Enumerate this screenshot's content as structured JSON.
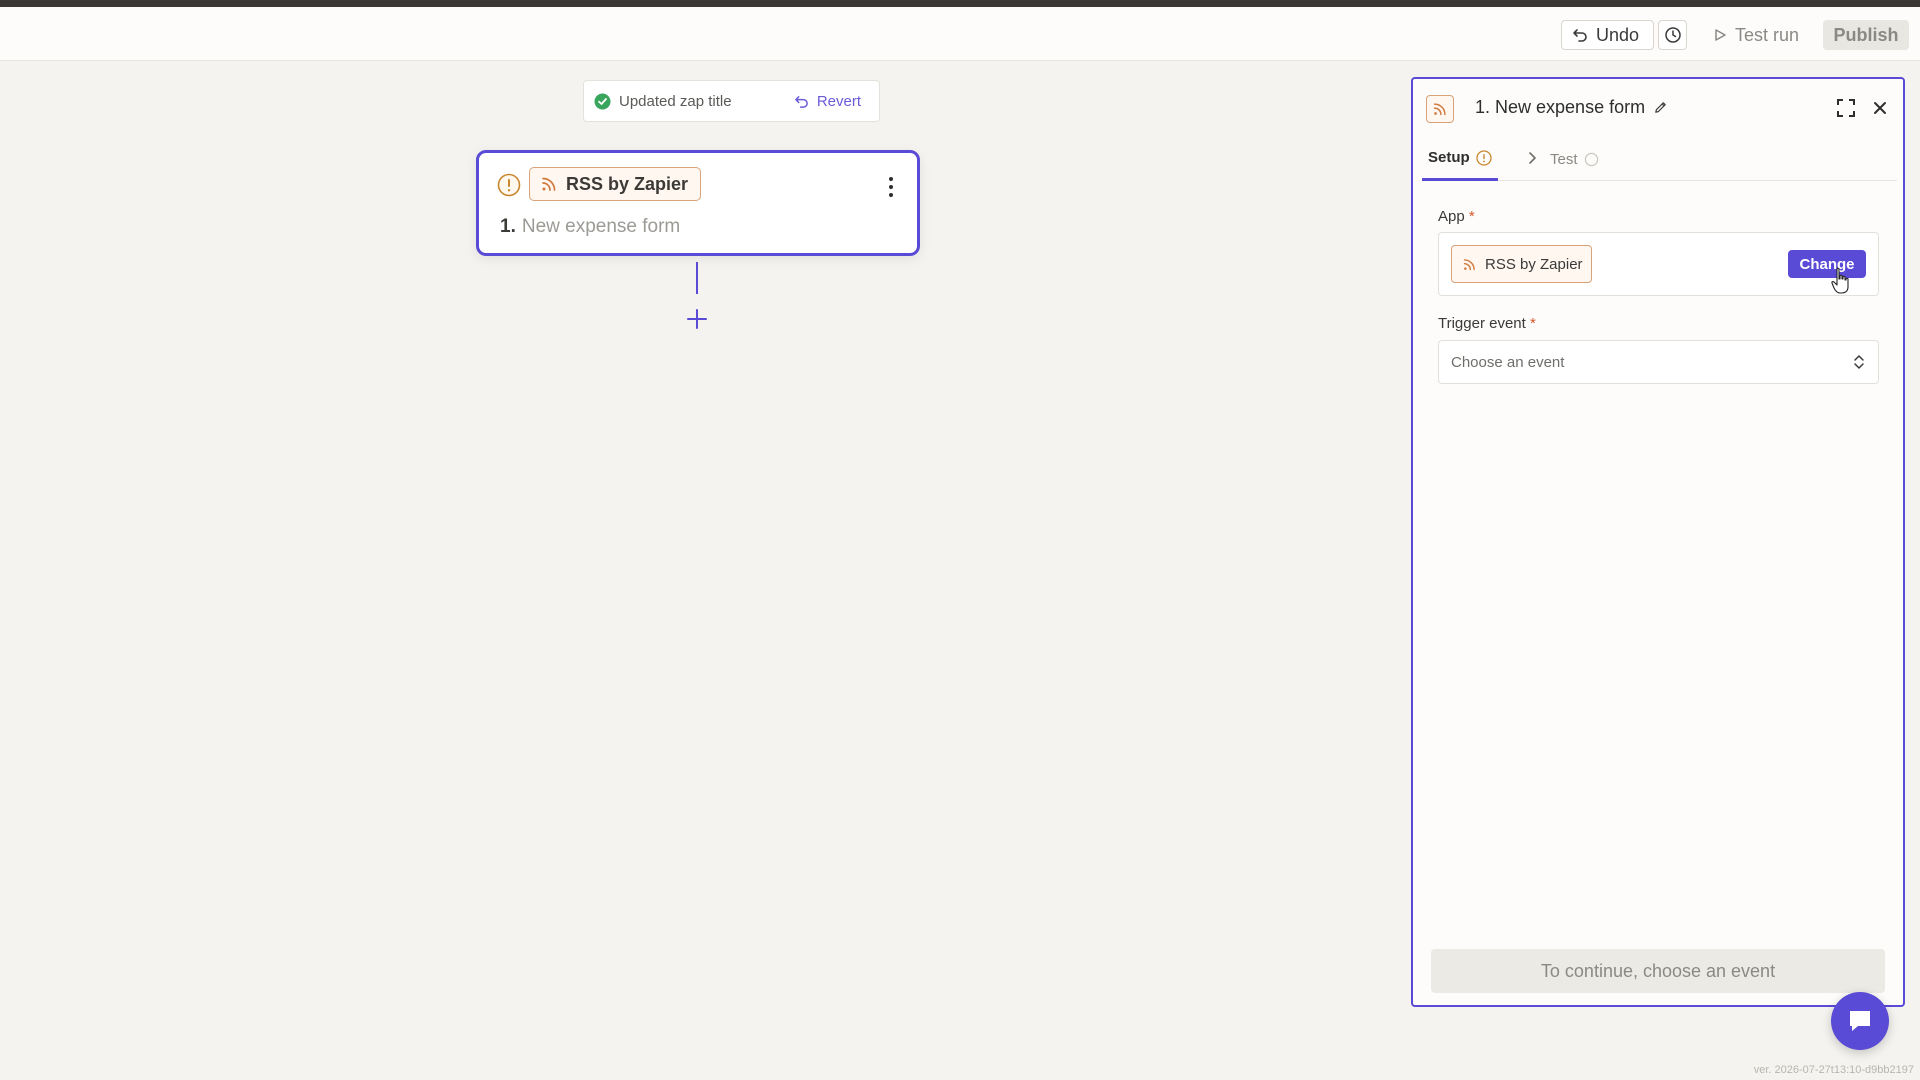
{
  "topbar": {
    "undo_label": "Undo",
    "testrun_label": "Test run",
    "publish_label": "Publish"
  },
  "toast": {
    "message": "Updated zap title",
    "action_label": "Revert"
  },
  "canvas": {
    "step": {
      "app_name": "RSS by Zapier",
      "number": "1.",
      "title": "New expense form"
    }
  },
  "panel": {
    "title": "1. New expense form",
    "tabs": {
      "setup": "Setup",
      "test": "Test"
    },
    "app_field": {
      "label": "App",
      "required_mark": "*",
      "value": "RSS by Zapier",
      "change_label": "Change"
    },
    "trigger_field": {
      "label": "Trigger event",
      "required_mark": "*",
      "placeholder": "Choose an event"
    },
    "continue_label": "To continue, choose an event"
  },
  "version_text": "ver. 2026-07-27t13:10-d9bb2197",
  "icons": {
    "undo": "undo-icon",
    "history": "history-icon",
    "play": "play-icon",
    "success": "check-circle-icon",
    "revert": "revert-icon",
    "warning": "warning-icon",
    "rss": "rss-icon",
    "kebab": "kebab-icon",
    "plus": "plus-icon",
    "edit": "pencil-icon",
    "expand": "expand-icon",
    "close": "close-icon",
    "chevron": "chevron-right-icon",
    "chat": "chat-icon"
  },
  "colors": {
    "accent": "#5a4bd6",
    "success": "#3aa55d",
    "warning": "#c9882f",
    "app_orange": "#d8a37a"
  }
}
